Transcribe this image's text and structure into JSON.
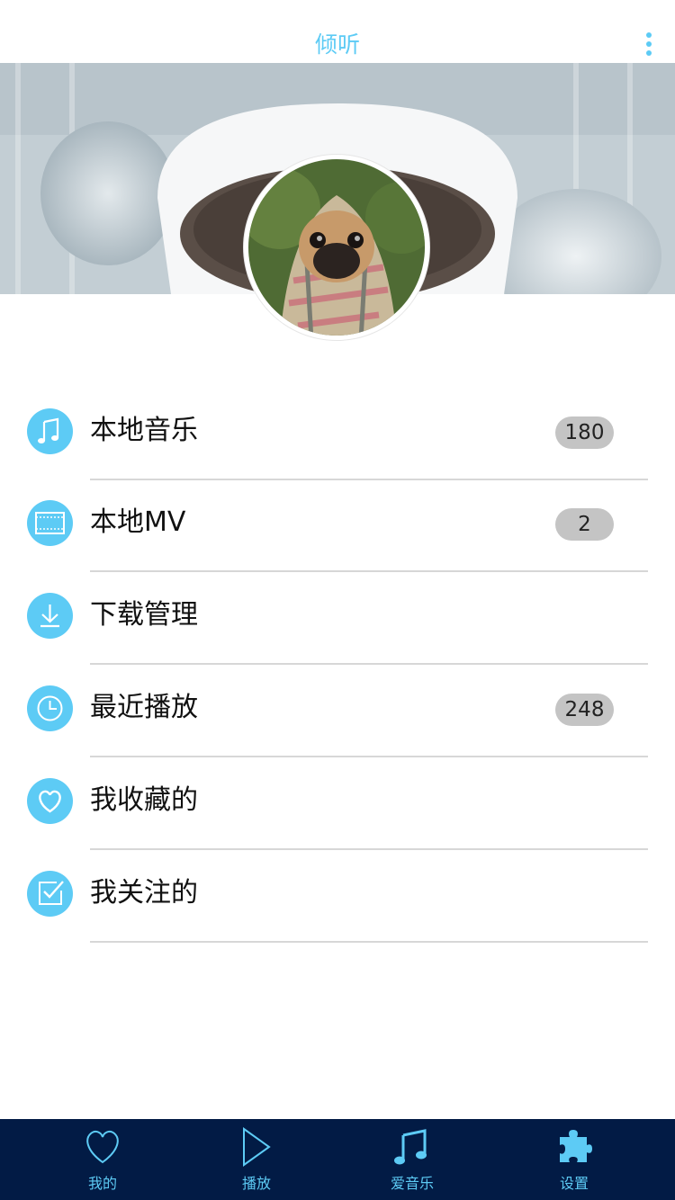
{
  "header": {
    "title": "倾听",
    "more_icon": "more-vertical-icon"
  },
  "banner": {
    "image": "coffee-cup-knit-sleeve-photo"
  },
  "profile": {
    "avatar": "pug-in-blanket-photo"
  },
  "menu": [
    {
      "label": "本地音乐",
      "icon": "music-note-icon",
      "count": "180"
    },
    {
      "label": "本地MV",
      "icon": "film-icon",
      "count": "2"
    },
    {
      "label": "下载管理",
      "icon": "download-icon",
      "count": ""
    },
    {
      "label": "最近播放",
      "icon": "clock-icon",
      "count": "248"
    },
    {
      "label": "我收藏的",
      "icon": "heart-icon",
      "count": ""
    },
    {
      "label": "我关注的",
      "icon": "checkbox-icon",
      "count": ""
    }
  ],
  "tabs": [
    {
      "label": "我的",
      "icon": "heart-outline-icon"
    },
    {
      "label": "播放",
      "icon": "play-outline-icon"
    },
    {
      "label": "爱音乐",
      "icon": "music-notes-icon"
    },
    {
      "label": "设置",
      "icon": "puzzle-icon"
    }
  ],
  "colors": {
    "accent": "#5dcbf5",
    "tabbar_bg": "#021b45",
    "badge_bg": "#c4c4c4",
    "divider": "#d7d7d7"
  }
}
